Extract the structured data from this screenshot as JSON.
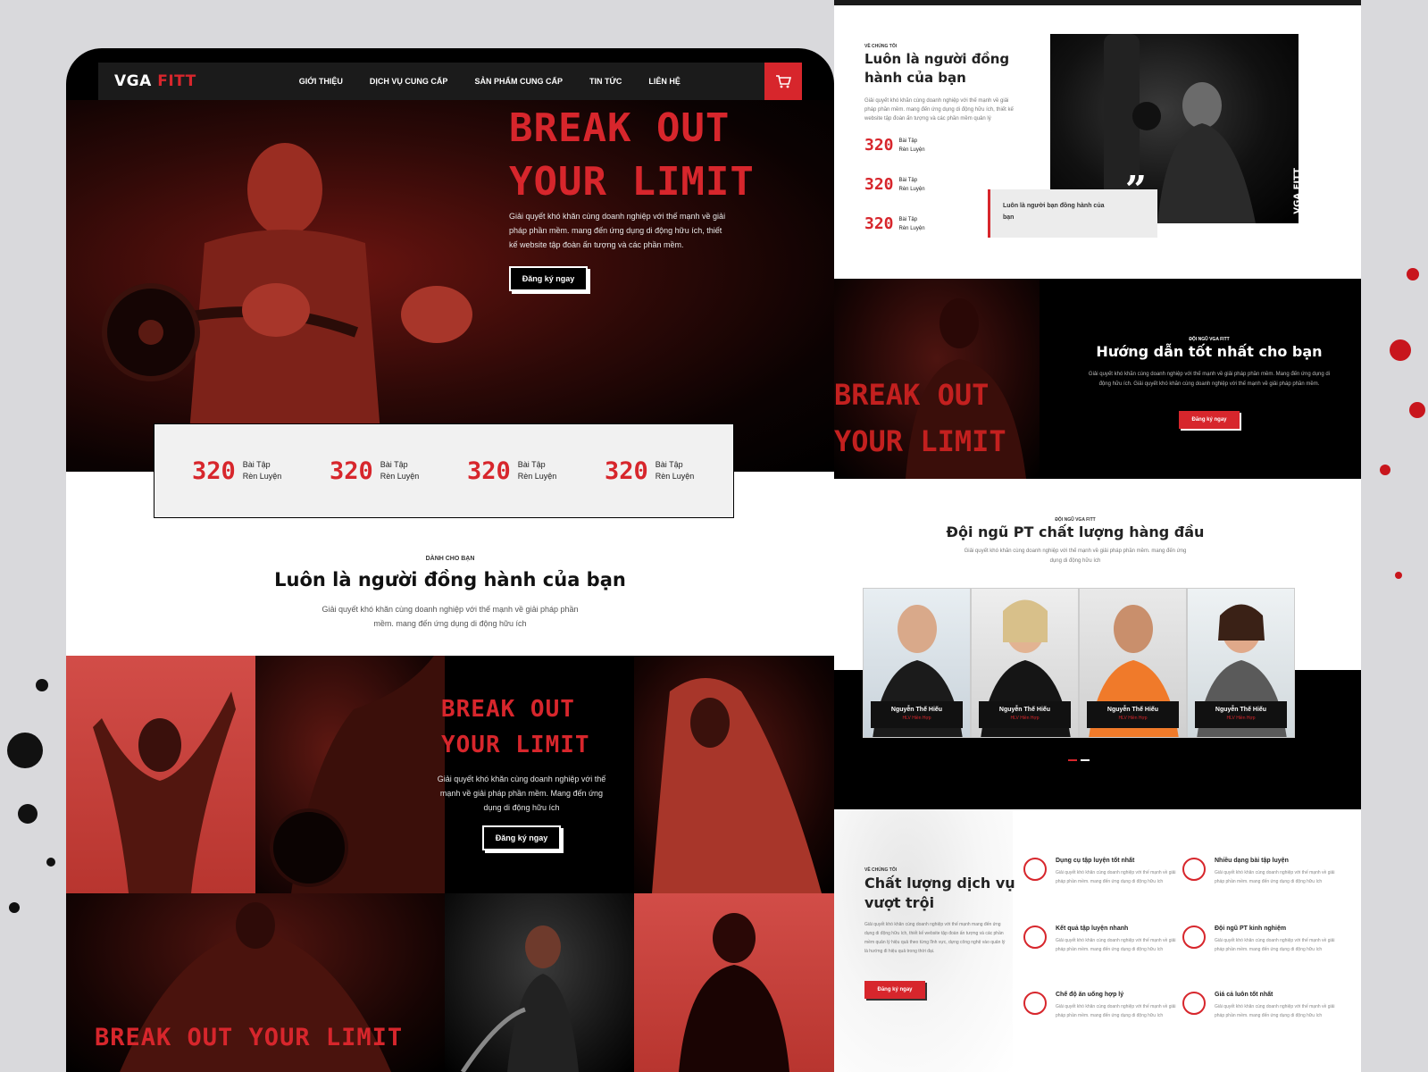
{
  "nav": {
    "logo_main": "VGA",
    "logo_accent": "FITT",
    "items": [
      "GIỚI THIỆU",
      "DỊCH VỤ CUNG CẤP",
      "SẢN PHẨM CUNG CẤP",
      "TIN TỨC",
      "LIÊN HỆ"
    ],
    "cart_icon": "cart-icon"
  },
  "hero": {
    "title_line1": "BREAK OUT",
    "title_line2": "YOUR LIMIT",
    "description": "Giải quyết khó khăn cùng doanh nghiệp với thế mạnh về giải pháp phần mềm.  mang đến ứng dụng di động hữu ích, thiết kế website tập đoàn ấn tượng và các phần mềm.",
    "cta": "Đăng ký ngay"
  },
  "stats": [
    {
      "number": "320",
      "label_1": "Bài Tập",
      "label_2": "Rèn Luyện"
    },
    {
      "number": "320",
      "label_1": "Bài Tập",
      "label_2": "Rèn Luyện"
    },
    {
      "number": "320",
      "label_1": "Bài Tập",
      "label_2": "Rèn Luyện"
    },
    {
      "number": "320",
      "label_1": "Bài Tập",
      "label_2": "Rèn Luyện"
    }
  ],
  "companion": {
    "tag": "DÀNH CHO BẠN",
    "title": "Luôn là người đồng hành của bạn",
    "description": "Giải quyết khó khăn cùng doanh nghiệp với thế mạnh về giải pháp phần mềm.  mang đến ứng dụng di động hữu ích"
  },
  "gallery": {
    "title_line1": "BREAK OUT",
    "title_line2": "YOUR LIMIT",
    "description": "Giải quyết khó khăn cùng doanh nghiệp với thế mạnh về giải pháp phần mềm. Mang đến ứng dụng di động hữu ích",
    "cta": "Đăng ký ngay",
    "bottom_title": "BREAK OUT YOUR LIMIT"
  },
  "about": {
    "tag": "VỀ CHÚNG TÔI",
    "title": "Luôn là người đồng hành của bạn",
    "description": "Giải quyết khó khăn cùng doanh nghiệp với thế mạnh về giải pháp phần mềm.  mang đến ứng dụng di động hữu ích, thiết kế website tập đoàn ấn tượng và các phần mềm quản lý",
    "stats": [
      {
        "number": "320",
        "label_1": "Bài Tập",
        "label_2": "Rèn Luyện"
      },
      {
        "number": "320",
        "label_1": "Bài Tập",
        "label_2": "Rèn Luyện"
      },
      {
        "number": "320",
        "label_1": "Bài Tập",
        "label_2": "Rèn Luyện"
      }
    ],
    "quote": "Luôn là người bạn đồng hành của bạn",
    "photo_brand": "VGA FITT"
  },
  "guide": {
    "stencil_line1": "BREAK OUT",
    "stencil_line2": "YOUR LIMIT",
    "tag": "ĐỘI NGŨ VGA FITT",
    "title": "Hướng dẫn tốt nhất cho bạn",
    "description": "Giải quyết khó khăn cùng doanh nghiệp với thế mạnh về giải pháp phần mềm. Mang đến ứng dụng di động hữu ích. Giải quyết khó khăn cùng doanh nghiệp với thế mạnh về giải pháp phần mềm.",
    "cta": "Đăng ký ngay"
  },
  "team": {
    "tag": "ĐỘI NGŨ VGA FITT",
    "title": "Đội ngũ PT chất lượng hàng đầu",
    "description": "Giải quyết khó khăn cùng doanh nghiệp với thế mạnh về giải pháp phần mềm.  mang đến ứng dụng di động hữu ích",
    "members": [
      {
        "name": "Nguyễn Thế Hiếu",
        "role": "HLV Hiền Hợp"
      },
      {
        "name": "Nguyễn Thế Hiếu",
        "role": "HLV Hiền Hợp"
      },
      {
        "name": "Nguyễn Thế Hiếu",
        "role": "HLV Hiền Hợp"
      },
      {
        "name": "Nguyễn Thế Hiếu",
        "role": "HLV Hiền Hợp"
      }
    ]
  },
  "quality": {
    "tag": "VỀ CHÚNG TÔI",
    "title": "Chất lượng dịch vụ vượt trội",
    "description": "Giải quyết khó khăn cùng doanh nghiệp với thế mạnh mang đến ứng dụng di động hữu ích, thiết kế website tập đoàn ấn tượng và các phần mềm quản lý hiệu quả theo từng lĩnh vực, dựng công nghệ vào quản lý là hướng đi hiệu quả trong thời đại.",
    "cta": "Đăng ký ngay",
    "features": [
      {
        "title": "Dụng cụ tập luyện tốt nhất",
        "description": "Giải quyết khó khăn cùng doanh nghiệp với thế mạnh về giải pháp phần mềm. mang đến ứng dụng di động hữu ích",
        "icon": "equipment-icon"
      },
      {
        "title": "Nhiều dạng bài tập luyện",
        "description": "Giải quyết khó khăn cùng doanh nghiệp với thế mạnh về giải pháp phần mềm. mang đến ứng dụng di động hữu ích",
        "icon": "workout-icon"
      },
      {
        "title": "Kết quả tập luyện nhanh",
        "description": "Giải quyết khó khăn cùng doanh nghiệp với thế mạnh về giải pháp phần mềm. mang đến ứng dụng di động hữu ích",
        "icon": "stopwatch-icon"
      },
      {
        "title": "Đội ngũ PT kinh nghiệm",
        "description": "Giải quyết khó khăn cùng doanh nghiệp với thế mạnh về giải pháp phần mềm. mang đến ứng dụng di động hữu ích",
        "icon": "trainer-icon"
      },
      {
        "title": "Chế độ ăn uống hợp lý",
        "description": "Giải quyết khó khăn cùng doanh nghiệp với thế mạnh về giải pháp phần mềm. mang đến ứng dụng di động hữu ích",
        "icon": "nutrition-icon"
      },
      {
        "title": "Giá cả luôn tốt nhất",
        "description": "Giải quyết khó khăn cùng doanh nghiệp với thế mạnh về giải pháp phần mềm. mang đến ứng dụng di động hữu ích",
        "icon": "price-icon"
      }
    ]
  },
  "colors": {
    "accent": "#d7262c",
    "dark": "#000000",
    "light": "#ffffff"
  }
}
